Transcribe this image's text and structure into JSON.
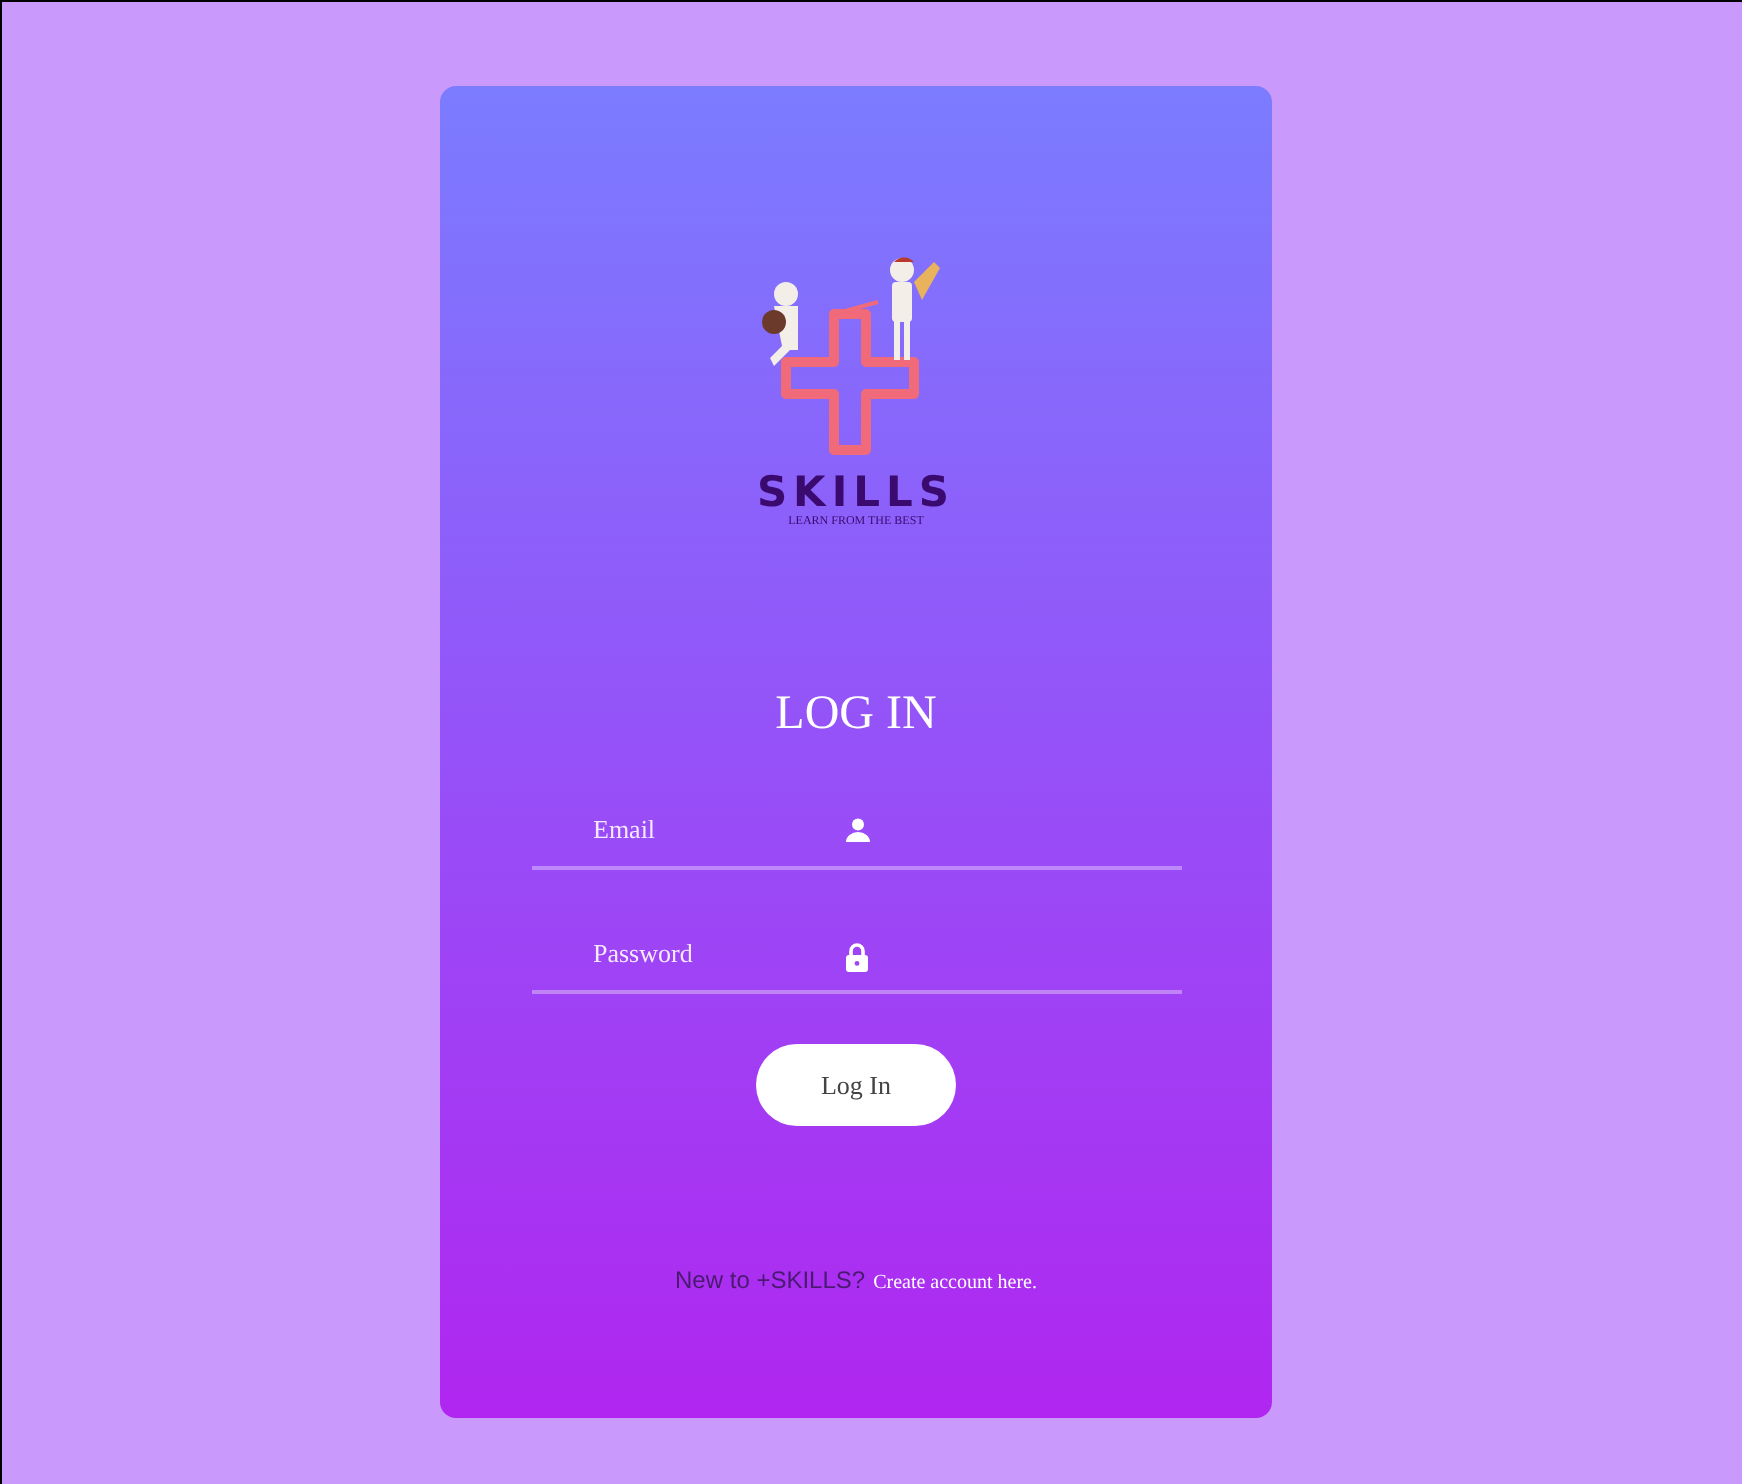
{
  "logo": {
    "name": "SKILLS",
    "tagline": "LEARN FROM THE BEST"
  },
  "heading": "LOG IN",
  "fields": [
    {
      "kind": "email",
      "placeholder": "Email"
    },
    {
      "kind": "password",
      "placeholder": "Password"
    }
  ],
  "submit": "Log In",
  "footer": {
    "text": "New to +SKILLS?",
    "link": "Create account here."
  }
}
